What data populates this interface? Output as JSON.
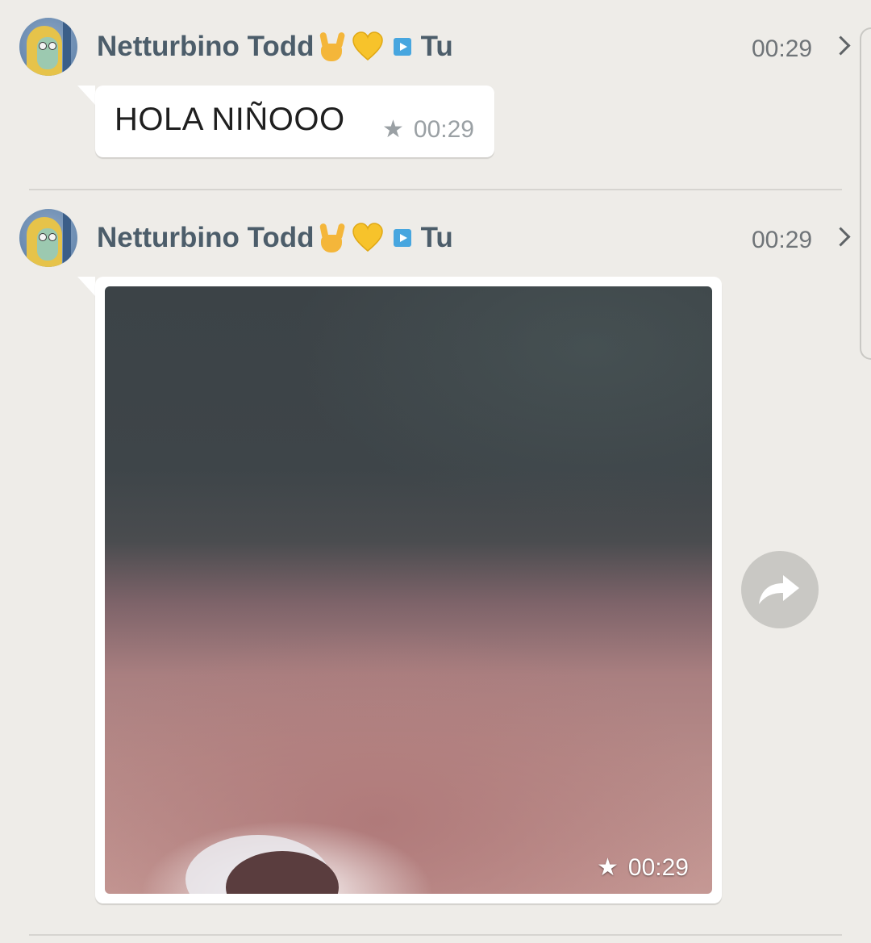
{
  "colors": {
    "background": "#eeece8",
    "sender_name": "#4c5d6a",
    "bubble": "#ffffff",
    "timestamp": "#9aa0a4",
    "header_time": "#6f7478",
    "play_badge": "#47a6df",
    "forward_button": "#c9c8c4"
  },
  "messages": [
    {
      "sender": "Netturbino Todd",
      "sender_emojis": [
        "sign-of-the-horns-emoji",
        "yellow-heart-emoji"
      ],
      "recipient": "Tu",
      "header_time": "00:29",
      "type": "text",
      "text": "HOLA NIÑOOO",
      "starred": true,
      "time": "00:29"
    },
    {
      "sender": "Netturbino Todd",
      "sender_emojis": [
        "sign-of-the-horns-emoji",
        "yellow-heart-emoji"
      ],
      "recipient": "Tu",
      "header_time": "00:29",
      "type": "photo",
      "starred": true,
      "time": "00:29"
    }
  ],
  "icons": {
    "star": "star-icon",
    "chevron": "chevron-right-icon",
    "forward": "forward-icon",
    "play_badge": "play-badge-icon"
  }
}
